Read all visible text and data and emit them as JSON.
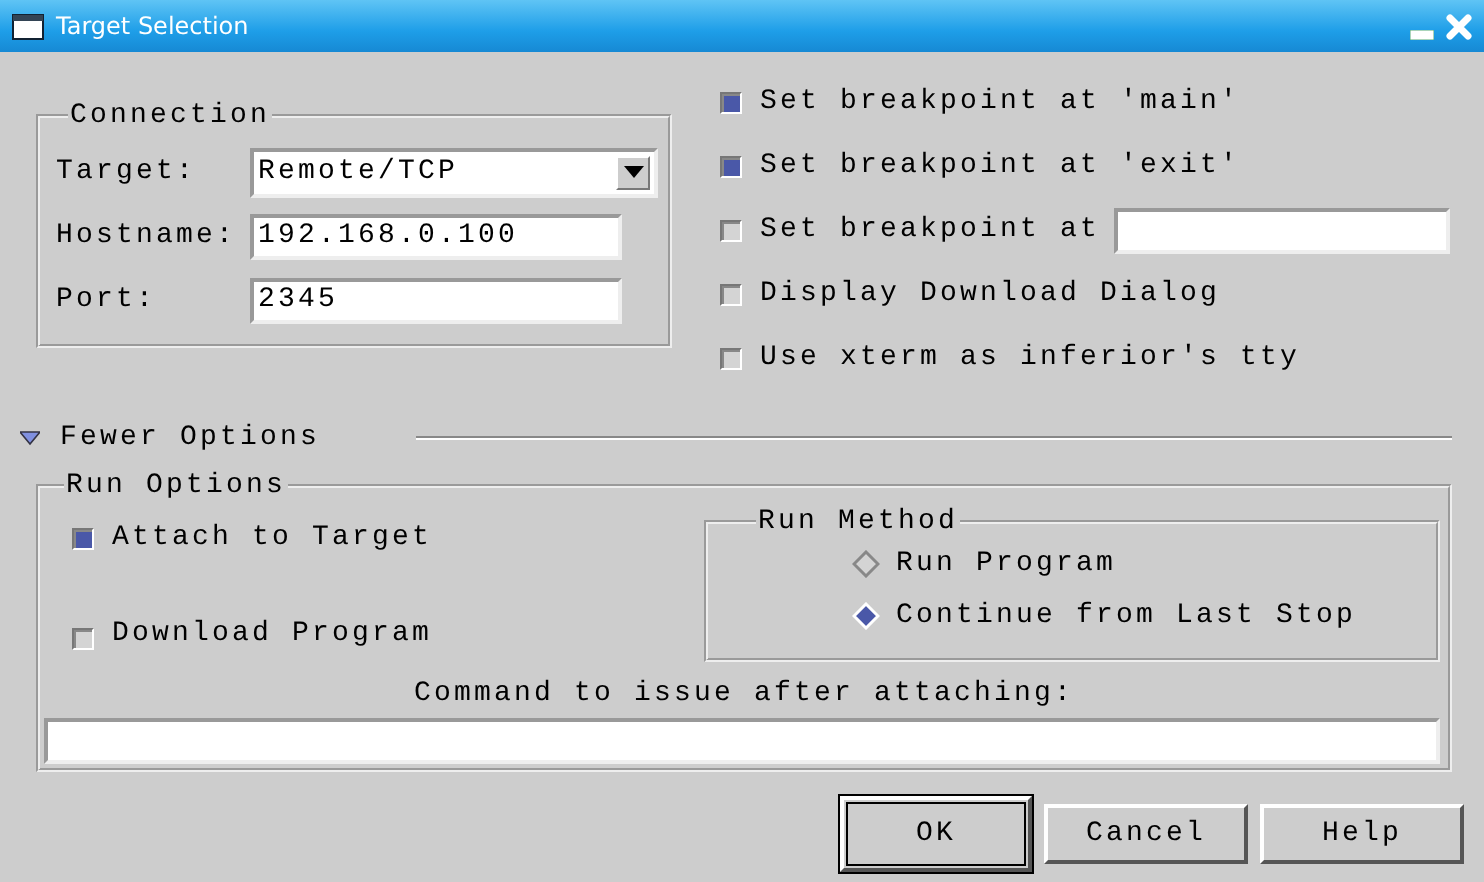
{
  "window": {
    "title": "Target Selection"
  },
  "connection": {
    "title": "Connection",
    "fields": [
      {
        "label": "Target:",
        "kind": "dropdown",
        "value": "Remote/TCP"
      },
      {
        "label": "Hostname:",
        "kind": "text",
        "value": "192.168.0.100"
      },
      {
        "label": "Port:",
        "kind": "text",
        "value": "2345"
      }
    ]
  },
  "options": [
    {
      "label": "Set breakpoint at 'main'",
      "kind": "check",
      "checked": true
    },
    {
      "label": "Set breakpoint at 'exit'",
      "kind": "check",
      "checked": true
    },
    {
      "label": "Set breakpoint at",
      "kind": "entry",
      "checked": false
    },
    {
      "label": "Display Download Dialog",
      "kind": "check",
      "checked": false
    },
    {
      "label": "Use xterm as inferior's tty",
      "kind": "check",
      "checked": false
    }
  ],
  "toggle": {
    "label": "Fewer Options",
    "expanded": true
  },
  "run_options": {
    "title": "Run Options",
    "checks": [
      {
        "label": "Attach to Target",
        "checked": true
      },
      {
        "label": "Download Program",
        "checked": false
      }
    ],
    "run_method": {
      "title": "Run Method",
      "choices": [
        {
          "label": "Run Program",
          "selected": false
        },
        {
          "label": "Continue from Last Stop",
          "selected": true
        }
      ]
    },
    "command": {
      "label": "Command to issue after attaching:"
    }
  },
  "buttons": [
    {
      "label": "OK",
      "default": true
    },
    {
      "label": "Cancel",
      "default": false
    },
    {
      "label": "Help",
      "default": false
    }
  ]
}
